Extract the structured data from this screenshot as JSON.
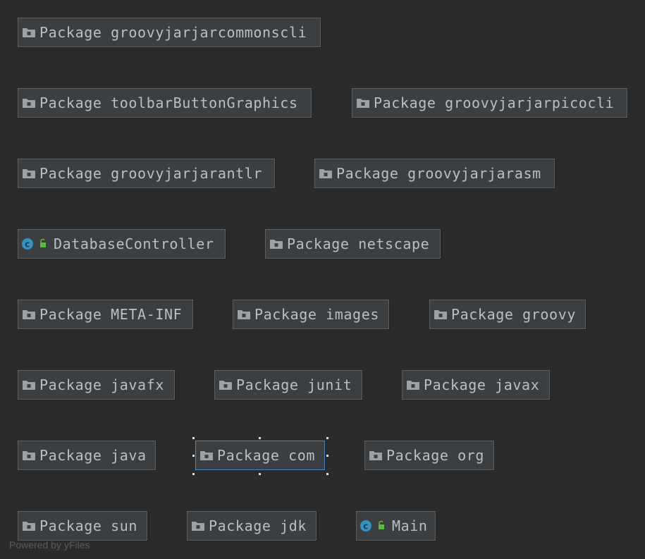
{
  "diagram": {
    "nodes": [
      {
        "id": "n1",
        "kind": "package",
        "label": "Package groovyjarjarcommonscli"
      },
      {
        "id": "n2",
        "kind": "package",
        "label": "Package toolbarButtonGraphics"
      },
      {
        "id": "n3",
        "kind": "package",
        "label": "Package groovyjarjarpicocli"
      },
      {
        "id": "n4",
        "kind": "package",
        "label": "Package groovyjarjarantlr"
      },
      {
        "id": "n5",
        "kind": "package",
        "label": "Package groovyjarjarasm"
      },
      {
        "id": "n6",
        "kind": "class",
        "label": "DatabaseController"
      },
      {
        "id": "n7",
        "kind": "package",
        "label": "Package netscape"
      },
      {
        "id": "n8",
        "kind": "package",
        "label": "Package META-INF"
      },
      {
        "id": "n9",
        "kind": "package",
        "label": "Package images"
      },
      {
        "id": "n10",
        "kind": "package",
        "label": "Package groovy"
      },
      {
        "id": "n11",
        "kind": "package",
        "label": "Package javafx"
      },
      {
        "id": "n12",
        "kind": "package",
        "label": "Package junit"
      },
      {
        "id": "n13",
        "kind": "package",
        "label": "Package javax"
      },
      {
        "id": "n14",
        "kind": "package",
        "label": "Package java"
      },
      {
        "id": "n15",
        "kind": "package",
        "label": "Package com",
        "selected": true
      },
      {
        "id": "n16",
        "kind": "package",
        "label": "Package org"
      },
      {
        "id": "n17",
        "kind": "package",
        "label": "Package sun"
      },
      {
        "id": "n18",
        "kind": "package",
        "label": "Package jdk"
      },
      {
        "id": "n19",
        "kind": "class",
        "label": "Main"
      }
    ],
    "watermark": "Powered by yFiles"
  }
}
